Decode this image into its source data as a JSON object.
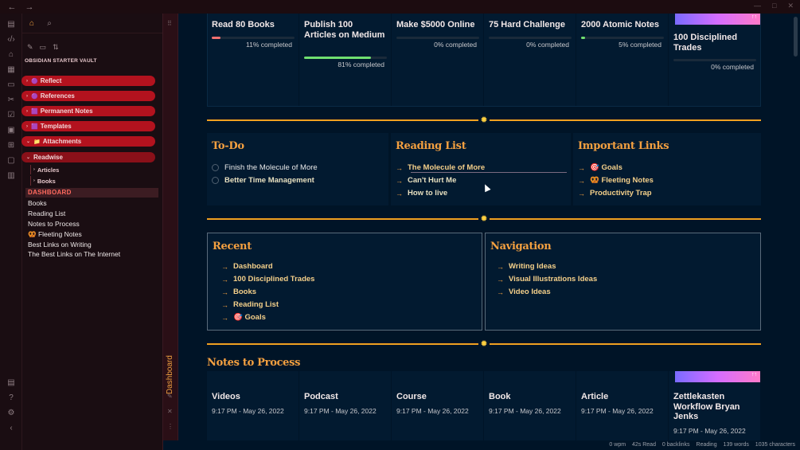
{
  "topbar": {
    "back_icon": "arrow-left-icon",
    "forward_icon": "arrow-right-icon",
    "win_buttons": [
      "—",
      "□",
      "✕"
    ]
  },
  "sidebar": {
    "vault_name": "OBSIDIAN STARTER VAULT",
    "folders": [
      {
        "label": "Reflect",
        "icon": "🟣",
        "expanded": false
      },
      {
        "label": "References",
        "icon": "🟣",
        "expanded": false
      },
      {
        "label": "Permanent Notes",
        "icon": "🟪",
        "expanded": false
      },
      {
        "label": "Templates",
        "icon": "🟪",
        "expanded": false
      },
      {
        "label": "Attachments",
        "icon": "📁",
        "expanded": true
      }
    ],
    "readwise": {
      "label": "Readwise",
      "children": [
        "Articles",
        "Books"
      ]
    },
    "active_file": "DASHBOARD",
    "files": [
      "Books",
      "Reading List",
      "Notes to Process",
      "Fleeting Notes",
      "Best Links on Writing",
      "The Best Links on The Internet"
    ],
    "fleeting_icon": "🥨"
  },
  "tabstrip": {
    "vertical_tab": "Dashboard"
  },
  "goals": [
    {
      "title": "Read 80 Books",
      "progress": 11,
      "label": "11% completed",
      "color": "#f07070"
    },
    {
      "title": "Publish 100 Articles on Medium",
      "progress": 81,
      "label": "81% completed",
      "color": "#70e070"
    },
    {
      "title": "Make $5000 Online",
      "progress": 0,
      "label": "0% completed",
      "color": "#70e070"
    },
    {
      "title": "75 Hard Challenge",
      "progress": 0,
      "label": "0% completed",
      "color": "#70e070"
    },
    {
      "title": "2000 Atomic Notes",
      "progress": 5,
      "label": "5% completed",
      "color": "#70e070"
    },
    {
      "title": "100 Disciplined Trades",
      "progress": 0,
      "label": "0% completed",
      "color": "#70e070"
    }
  ],
  "banner_glyph": "↑↑",
  "divider_glyph": "✹",
  "todo": {
    "title": "To-Do",
    "items": [
      "Finish the Molecule of More",
      "Better Time Management"
    ]
  },
  "reading_list": {
    "title": "Reading List",
    "items": [
      "The Molecule of More",
      "Can't Hurt Me",
      "How to live"
    ]
  },
  "important_links": {
    "title": "Important Links",
    "items": [
      {
        "icon": "🎯",
        "label": "Goals"
      },
      {
        "icon": "🥨",
        "label": "Fleeting Notes"
      },
      {
        "icon": "",
        "label": "Productivity Trap"
      }
    ]
  },
  "recent": {
    "title": "Recent",
    "items": [
      {
        "icon": "",
        "label": "Dashboard"
      },
      {
        "icon": "",
        "label": "100 Disciplined Trades"
      },
      {
        "icon": "",
        "label": "Books"
      },
      {
        "icon": "",
        "label": "Reading List"
      },
      {
        "icon": "🎯",
        "label": "Goals"
      }
    ]
  },
  "navigation": {
    "title": "Navigation",
    "items": [
      "Writing Ideas",
      "Visual Illustrations Ideas",
      "Video Ideas"
    ]
  },
  "notes_to_process": {
    "title": "Notes to Process",
    "cards": [
      {
        "title": "Videos",
        "date": "9:17 PM - May 26, 2022"
      },
      {
        "title": "Podcast",
        "date": "9:17 PM - May 26, 2022"
      },
      {
        "title": "Course",
        "date": "9:17 PM - May 26, 2022"
      },
      {
        "title": "Book",
        "date": "9:17 PM - May 26, 2022"
      },
      {
        "title": "Article",
        "date": "9:17 PM - May 26, 2022"
      },
      {
        "title": "Zettlekasten Workflow Bryan Jenks",
        "date": "9:17 PM - May 26, 2022"
      }
    ]
  },
  "status": {
    "wpm": "0 wpm",
    "read": "42s Read",
    "backlinks": "0 backlinks",
    "mode": "Reading",
    "words": "139 words",
    "chars": "1035 characters"
  }
}
